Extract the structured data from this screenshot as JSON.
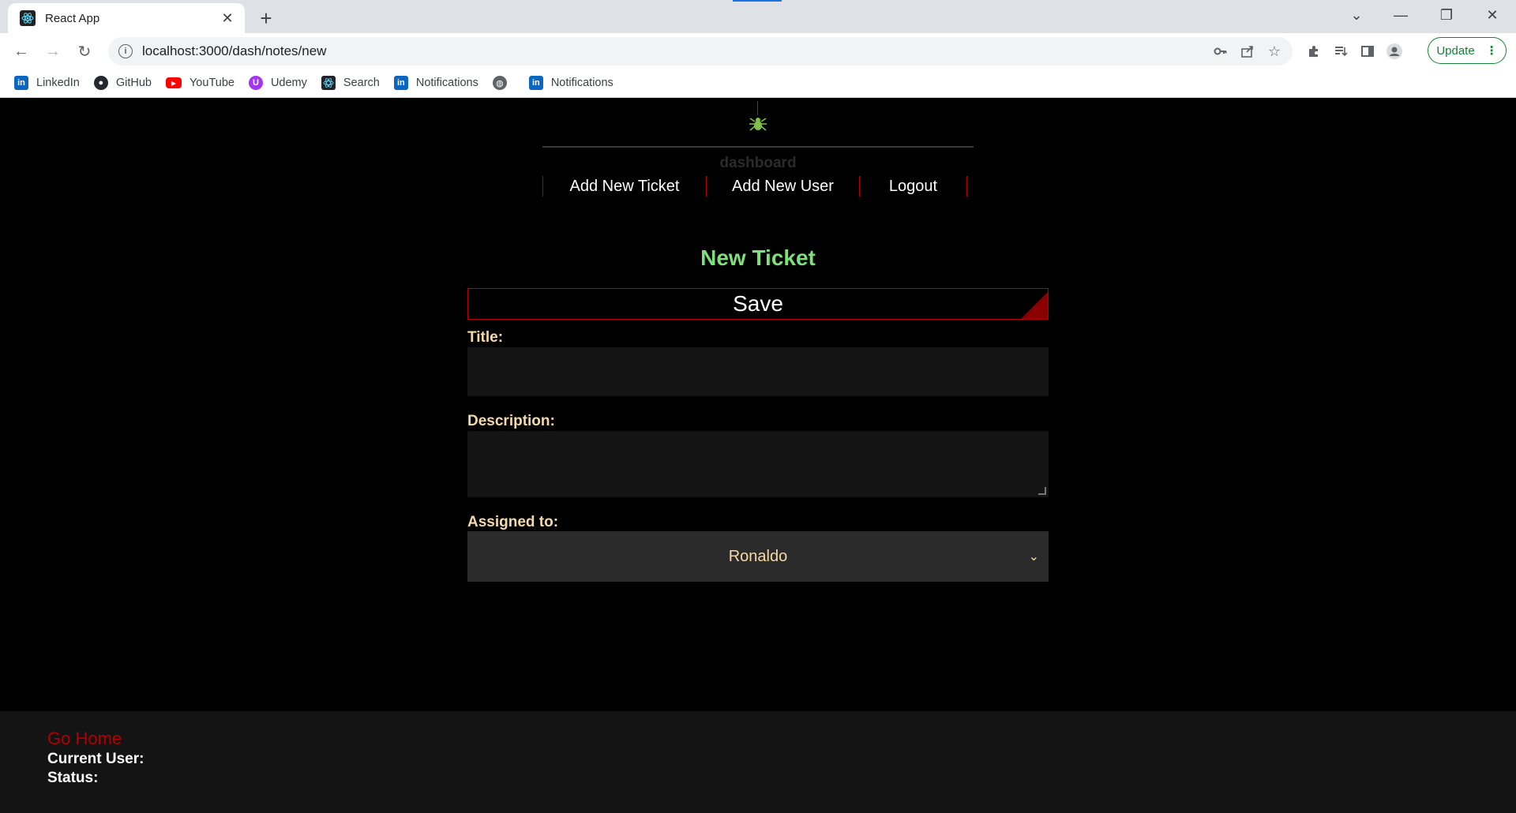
{
  "browser": {
    "tab_title": "React App",
    "url": "localhost:3000/dash/notes/new",
    "update_label": "Update",
    "bookmarks": [
      {
        "label": "LinkedIn",
        "icon": "linkedin-icon",
        "color": "#0a66c2"
      },
      {
        "label": "GitHub",
        "icon": "github-icon",
        "color": "#24292f"
      },
      {
        "label": "YouTube",
        "icon": "youtube-icon",
        "color": "#ff0000"
      },
      {
        "label": "Udemy",
        "icon": "udemy-icon",
        "color": "#a435f0"
      },
      {
        "label": "Search",
        "icon": "react-icon",
        "color": "#20232a"
      },
      {
        "label": "Notifications",
        "icon": "linkedin-icon",
        "color": "#0a66c2"
      },
      {
        "label": "",
        "icon": "globe-icon",
        "color": "#5f6368"
      },
      {
        "label": "Notifications",
        "icon": "linkedin-icon",
        "color": "#0a66c2"
      }
    ]
  },
  "app": {
    "dashboard_label": "dashboard",
    "menu": [
      "Add New Ticket",
      "Add New User",
      "Logout"
    ],
    "page_title": "New Ticket",
    "save_label": "Save",
    "title_label": "Title:",
    "description_label": "Description:",
    "assigned_label": "Assigned to:",
    "assigned_value": "Ronaldo",
    "accent_red": "#b00000",
    "title_green": "#7ee07a"
  },
  "footer": {
    "go_home": "Go Home",
    "current_user": "Current User:",
    "status": "Status:"
  }
}
